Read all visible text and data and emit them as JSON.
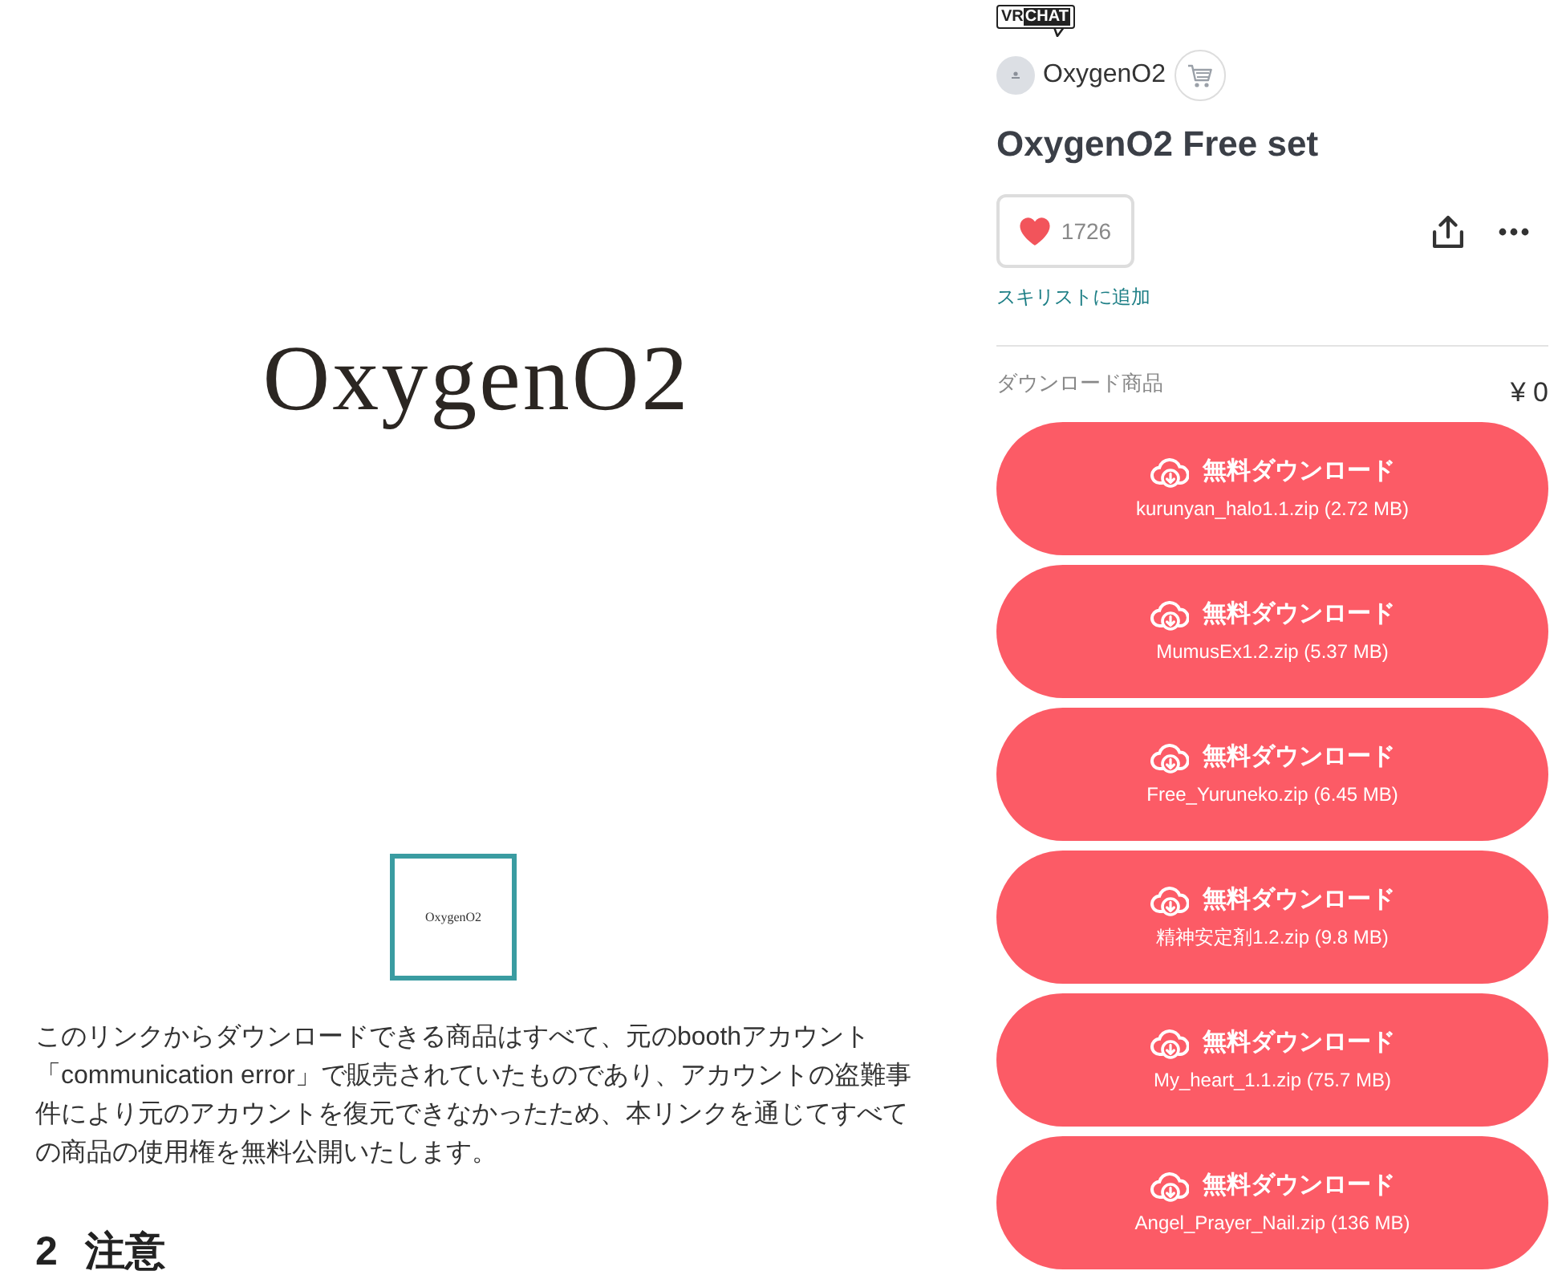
{
  "product_image": {
    "logo_text": "OxygenO2"
  },
  "thumbnails": [
    {
      "logo_text": "OxygenO2",
      "selected": true
    }
  ],
  "description": "このリンクからダウンロードできる商品はすべて、元のboothアカウント「communication error」で販売されていたものであり、アカウントの盗難事件により元のアカウントを復元できなかったため、本リンクを通じてすべての商品の使用権を無料公開いたします。",
  "section_heading": {
    "number": "2",
    "title": "注意"
  },
  "platform_badge": {
    "parts": [
      "VR",
      "CHAT"
    ]
  },
  "shop": {
    "name": "OxygenO2"
  },
  "title": "OxygenO2 Free set",
  "like": {
    "count": "1726"
  },
  "wishlist_link": "スキリストに追加",
  "downloads": {
    "label": "ダウンロード商品",
    "price": "¥ 0",
    "items": [
      {
        "button": "無料ダウンロード",
        "file": "kurunyan_halo1.1.zip (2.72 MB)"
      },
      {
        "button": "無料ダウンロード",
        "file": "MumusEx1.2.zip (5.37 MB)"
      },
      {
        "button": "無料ダウンロード",
        "file": "Free_Yuruneko.zip (6.45 MB)"
      },
      {
        "button": "無料ダウンロード",
        "file": "精神安定剤1.2.zip (9.8 MB)"
      },
      {
        "button": "無料ダウンロード",
        "file": "My_heart_1.1.zip (75.7 MB)"
      },
      {
        "button": "無料ダウンロード",
        "file": "Angel_Prayer_Nail.zip (136 MB)"
      }
    ]
  }
}
